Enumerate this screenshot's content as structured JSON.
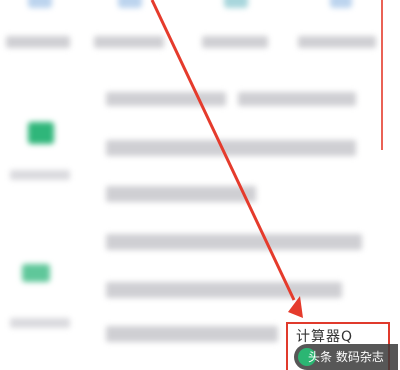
{
  "highlight": {
    "label": "计算器Q"
  },
  "watermark": {
    "prefix": "头条",
    "name": "数码杂志"
  },
  "colors": {
    "arrow": "#e53b2c",
    "box": "#e03a2c",
    "icon_green": "#2bb673",
    "icon_blue": "#a9c8e8"
  },
  "icons": {
    "top": [
      "app-icon",
      "app-icon",
      "app-icon",
      "app-icon"
    ],
    "side": [
      "green-app-icon",
      "green-app-icon"
    ]
  }
}
